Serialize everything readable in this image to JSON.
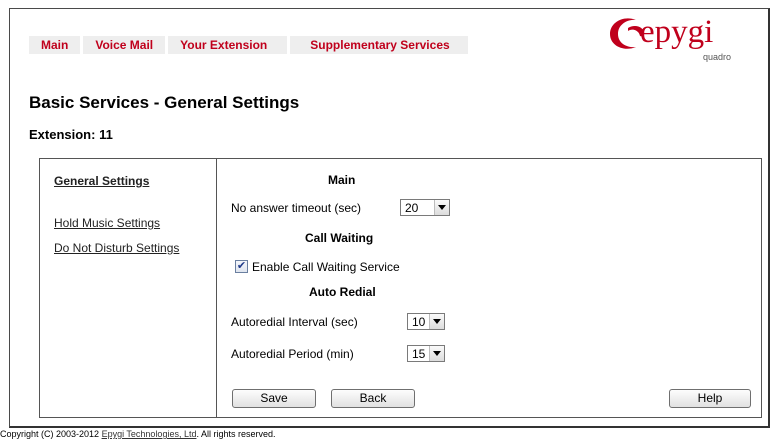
{
  "nav": {
    "tabs": [
      "Main",
      "Voice Mail",
      "Your Extension",
      "Supplementary Services"
    ]
  },
  "logo": {
    "brand": "epygi",
    "sub": "quadro"
  },
  "page": {
    "title": "Basic Services - General Settings",
    "extension": "Extension: 11"
  },
  "sidebar": {
    "items": [
      {
        "label": "General Settings"
      },
      {
        "label": "Hold Music Settings"
      },
      {
        "label": "Do Not Disturb Settings"
      }
    ]
  },
  "form": {
    "main_heading": "Main",
    "no_answer_label": "No answer timeout (sec)",
    "no_answer_value": "20",
    "call_waiting_heading": "Call Waiting",
    "call_waiting_label": "Enable Call Waiting Service",
    "call_waiting_checked": true,
    "auto_redial_heading": "Auto Redial",
    "interval_label": "Autoredial Interval (sec)",
    "interval_value": "10",
    "period_label": "Autoredial Period (min)",
    "period_value": "15"
  },
  "buttons": {
    "save": "Save",
    "back": "Back",
    "help": "Help"
  },
  "footer": {
    "prefix": "Copyright (C) 2003-2012 ",
    "link": "Epygi Technologies, Ltd",
    "suffix": ". All rights reserved."
  },
  "colors": {
    "accent": "#c0001c",
    "nav_bg": "#eeeeee"
  }
}
